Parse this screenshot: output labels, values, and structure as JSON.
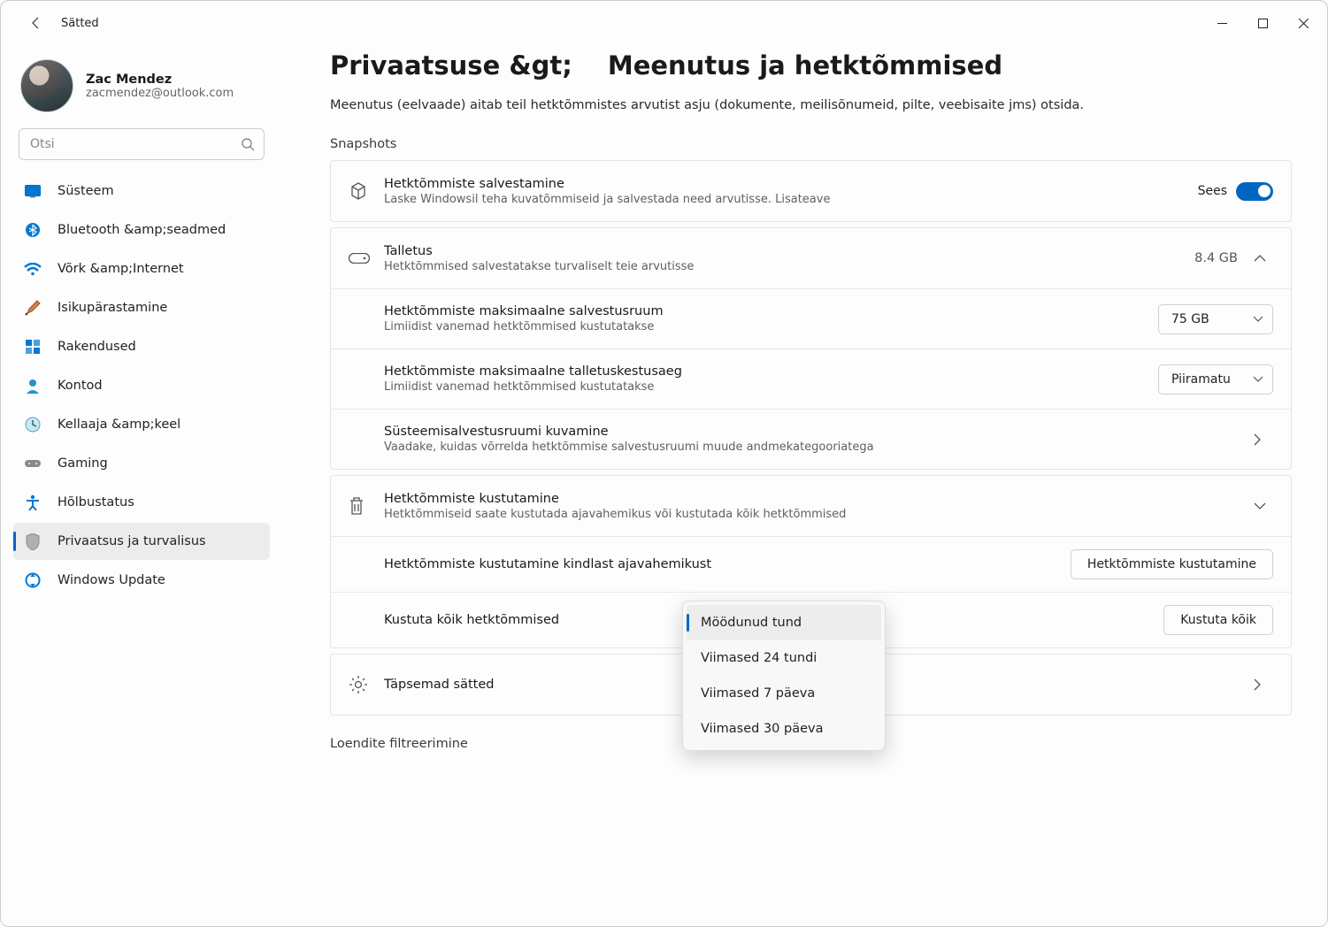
{
  "app_title": "Sätted",
  "profile": {
    "name": "Zac Mendez",
    "email": "zacmendez@outlook.com"
  },
  "search": {
    "placeholder": "Otsi"
  },
  "nav": {
    "system": "Süsteem",
    "bluetooth": "Bluetooth &amp;seadmed",
    "network": "Võrk &amp;Internet",
    "personal": "Isikupärastamine",
    "apps": "Rakendused",
    "accounts": "Kontod",
    "time": "Kellaaja &amp;keel",
    "gaming": "Gaming",
    "access": "Hõlbustatus",
    "privacy": "Privaatsus ja turvalisus",
    "update": "Windows Update"
  },
  "breadcrumb": {
    "parent": "Privaatsuse &gt;",
    "current": "Meenutus ja hetktõmmised"
  },
  "desc": "Meenutus (eelvaade) aitab teil hetktõmmistes arvutist asju (dokumente, meilisõnumeid, pilte, veebisaite jms) otsida.",
  "section_snapshots": "Snapshots",
  "save_snapshots": {
    "title": "Hetktõmmiste salvestamine",
    "sub": "Laske Windowsil teha kuvatõmmiseid ja salvestada need arvutisse. Lisateave",
    "state_label": "Sees"
  },
  "storage": {
    "title": "Talletus",
    "sub": "Hetktõmmised salvestatakse turvaliselt teie arvutisse",
    "size": "8.4 GB"
  },
  "max_storage": {
    "title": "Hetktõmmiste maksimaalne salvestusruum",
    "sub": "Limiidist vanemad hetktõmmised kustutatakse",
    "value": "75 GB"
  },
  "max_duration": {
    "title": "Hetktõmmiste maksimaalne talletuskestusaeg",
    "sub": "Limiidist vanemad hetktõmmised kustutatakse",
    "value": "Piiramatu"
  },
  "sys_storage": {
    "title": "Süsteemisalvestusruumi kuvamine",
    "sub": "Vaadake, kuidas võrrelda hetktõmmise salvestusruumi muude andmekategooriatega"
  },
  "delete": {
    "title": "Hetktõmmiste kustutamine",
    "sub": "Hetktõmmiseid saate kustutada ajavahemikus või kustutada kõik hetktõmmised"
  },
  "delete_range": {
    "title": "Hetktõmmiste kustutamine kindlast ajavahemikust",
    "button": "Hetktõmmiste kustutamine"
  },
  "delete_all": {
    "title": "Kustuta kõik hetktõmmised",
    "button": "Kustuta kõik"
  },
  "popup": {
    "opt0": "Möödunud tund",
    "opt1": "Viimased 24 tundi",
    "opt2": "Viimased 7 päeva",
    "opt3": "Viimased 30 päeva"
  },
  "advanced": "Täpsemad sätted",
  "filter_section": "Loendite filtreerimine"
}
